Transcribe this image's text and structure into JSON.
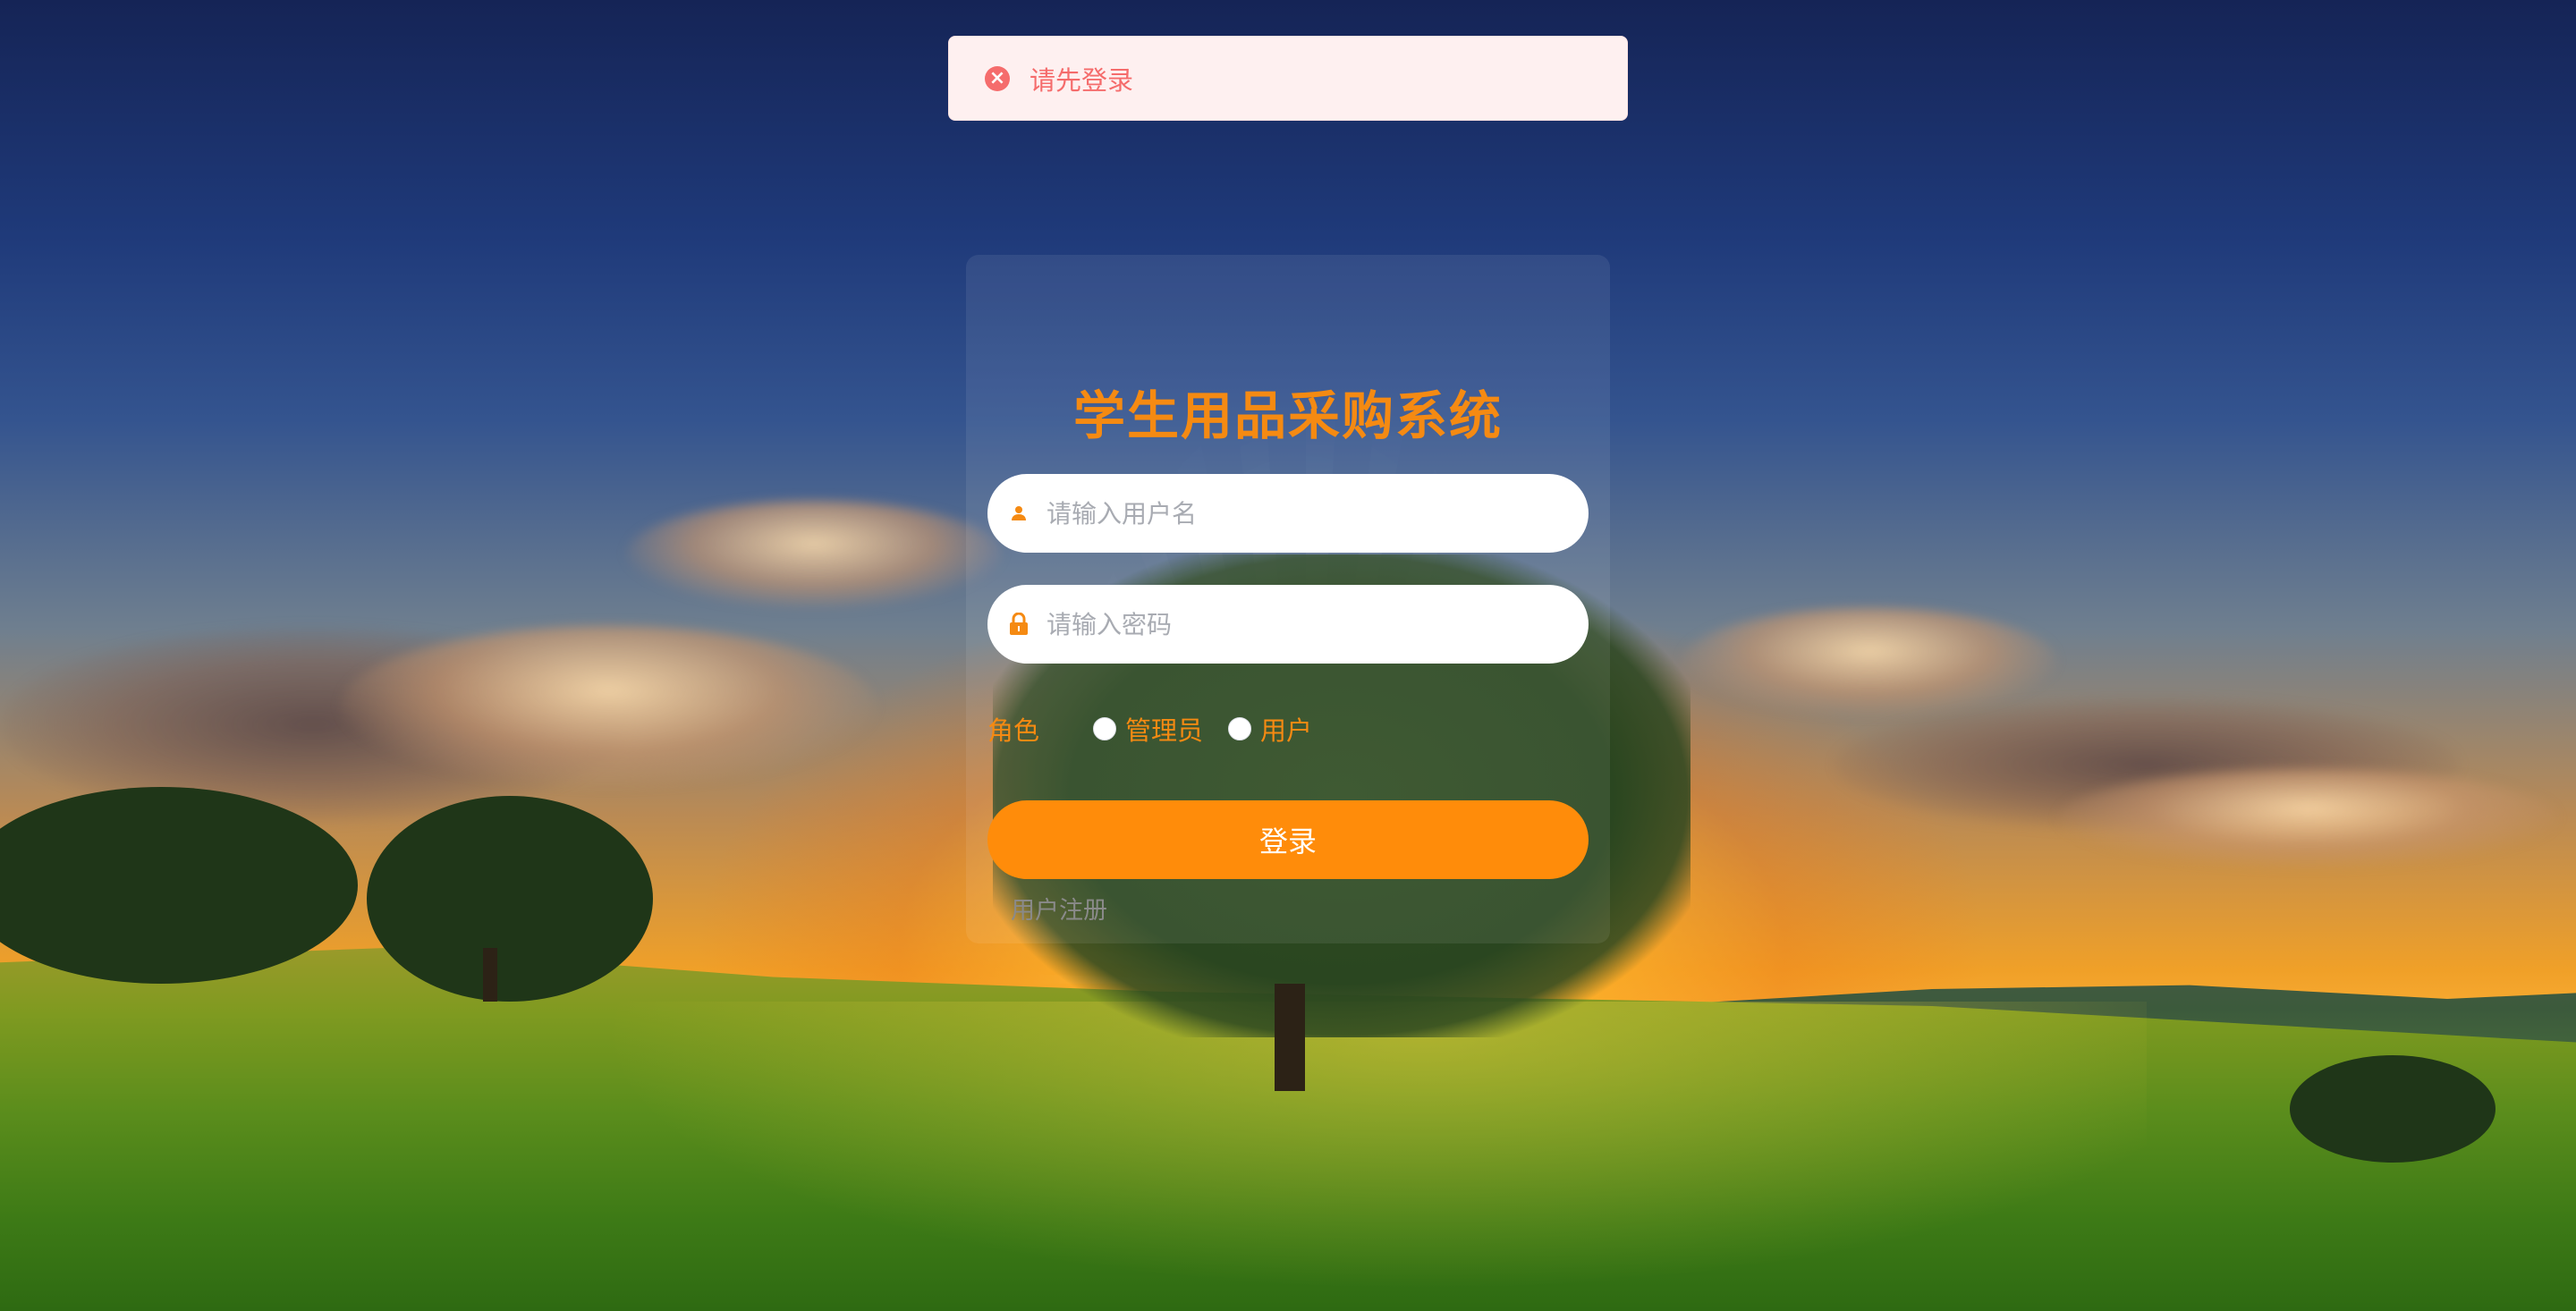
{
  "toast": {
    "message": "请先登录",
    "icon": "error-circle-icon",
    "color": "#f56c6c"
  },
  "login": {
    "title": "学生用品采购系统",
    "username_placeholder": "请输入用户名",
    "password_placeholder": "请输入密码",
    "role_label": "角色",
    "roles": [
      "管理员",
      "用户"
    ],
    "submit_label": "登录",
    "register_label": "用户注册",
    "accent_color": "#ff8c0a"
  }
}
